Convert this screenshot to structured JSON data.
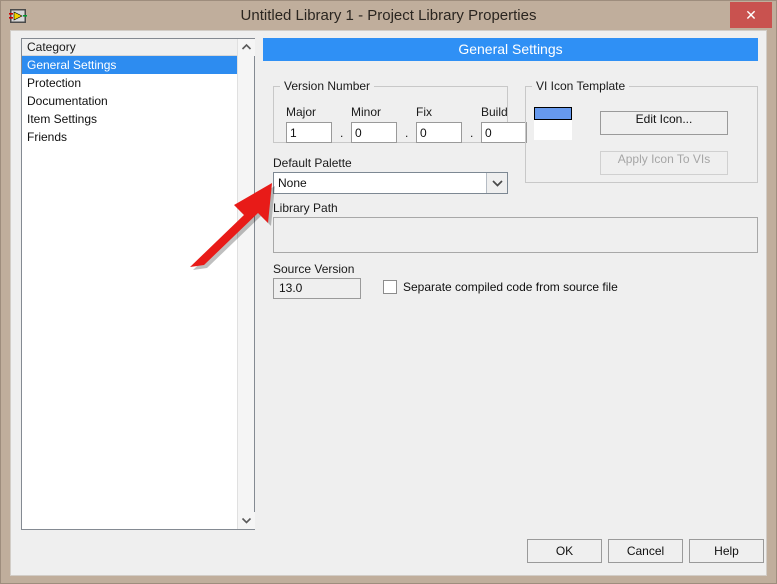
{
  "window": {
    "title": "Untitled Library 1 - Project Library Properties",
    "icon": "labview-icon",
    "close_label": "✕",
    "frame_color": "#c0ae9c",
    "close_color": "#c9524f"
  },
  "category_list": {
    "header": "Category",
    "items": [
      {
        "label": "General Settings",
        "selected": true
      },
      {
        "label": "Protection",
        "selected": false
      },
      {
        "label": "Documentation",
        "selected": false
      },
      {
        "label": "Item Settings",
        "selected": false
      },
      {
        "label": "Friends",
        "selected": false
      }
    ],
    "selection_color": "#2d8cf0",
    "scroll_up": "▲",
    "scroll_down": "▼"
  },
  "settings": {
    "header": "General Settings",
    "header_color": "#2f90f5",
    "version_number": {
      "legend": "Version Number",
      "fields": [
        {
          "label": "Major",
          "value": "1"
        },
        {
          "label": "Minor",
          "value": "0"
        },
        {
          "label": "Fix",
          "value": "0"
        },
        {
          "label": "Build",
          "value": "0"
        }
      ],
      "separator": "."
    },
    "vi_icon_template": {
      "legend": "VI Icon Template",
      "edit_icon_label": "Edit Icon...",
      "apply_icon_label": "Apply Icon To VIs",
      "apply_icon_enabled": false,
      "preview_band_color": "#6699ee"
    },
    "default_palette": {
      "label": "Default Palette",
      "value": "None",
      "arrow": "⌄"
    },
    "library_path": {
      "label": "Library Path",
      "value": ""
    },
    "source_version": {
      "label": "Source Version",
      "value": "13.0"
    },
    "separate_compiled": {
      "label": "Separate compiled code from source file",
      "checked": false
    }
  },
  "footer": {
    "ok_label": "OK",
    "cancel_label": "Cancel",
    "help_label": "Help"
  },
  "annotation": {
    "type": "red-arrow",
    "color": "#e81b18",
    "points_to": "default-palette-combo"
  }
}
